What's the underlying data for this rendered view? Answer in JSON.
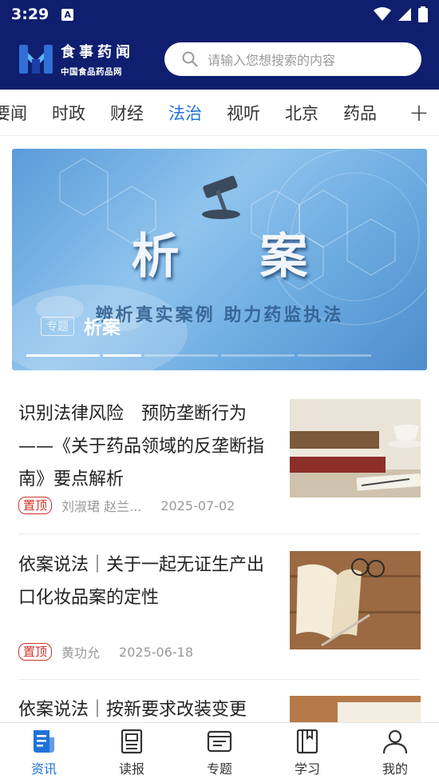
{
  "status": {
    "time": "3:29",
    "notif_letter": "A"
  },
  "header": {
    "logo_title": "食事药闻",
    "logo_subtitle": "中国食品药品网",
    "search_placeholder": "请输入您想搜索的内容"
  },
  "tabs": [
    {
      "label": "要闻",
      "active": false
    },
    {
      "label": "时政",
      "active": false
    },
    {
      "label": "财经",
      "active": false
    },
    {
      "label": "法治",
      "active": true
    },
    {
      "label": "视听",
      "active": false
    },
    {
      "label": "北京",
      "active": false
    },
    {
      "label": "药品",
      "active": false
    }
  ],
  "tab_add_label": "+",
  "banner": {
    "image_title": "析 案",
    "image_subtitle": "辨析真实案例 助力药监执法",
    "tag": "专题",
    "caption": "析案",
    "slide_count": 5,
    "active_slide": 2
  },
  "news": [
    {
      "title": "识别法律风险　预防垄断行为——《关于药品领域的反垄断指南》要点解析",
      "pin": "置顶",
      "author": "刘淑珺  赵兰...",
      "date": "2025-07-02",
      "thumb": "books-and-pen"
    },
    {
      "title": "依案说法｜关于一起无证生产出口化妆品案的定性",
      "pin": "置顶",
      "author": "黄功允",
      "date": "2025-06-18",
      "thumb": "open-book-glasses"
    },
    {
      "title": "依案说法｜按新要求改装变更",
      "pin": "",
      "author": "",
      "date": "",
      "thumb": "notebook"
    }
  ],
  "bottom_nav": [
    {
      "label": "资讯",
      "icon": "news-icon",
      "active": true
    },
    {
      "label": "读报",
      "icon": "newspaper-icon",
      "active": false
    },
    {
      "label": "专题",
      "icon": "topic-icon",
      "active": false
    },
    {
      "label": "学习",
      "icon": "study-book-icon",
      "active": false
    },
    {
      "label": "我的",
      "icon": "profile-icon",
      "active": false
    }
  ],
  "colors": {
    "brand_navy": "#0f1e6e",
    "accent_blue": "#1e73d8",
    "pin_red": "#d0332a"
  }
}
